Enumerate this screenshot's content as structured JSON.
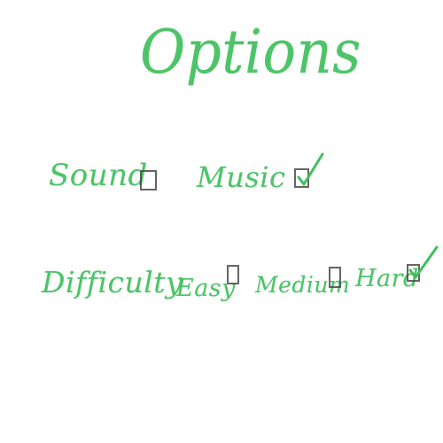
{
  "title": "Options",
  "sound": {
    "label": "Sound",
    "checked": false
  },
  "music": {
    "label": "Music",
    "checked": true
  },
  "difficulty": {
    "label": "Difficulty",
    "options": [
      {
        "label": "Easy",
        "checked": false
      },
      {
        "label": "Medium",
        "checked": false
      },
      {
        "label": "Hard",
        "checked": true
      }
    ]
  },
  "colors": {
    "text": "#3fbf5c",
    "checkbox_border": "#4a4a4a",
    "checkmark": "#3fbf5c",
    "background": "#ffffff"
  }
}
